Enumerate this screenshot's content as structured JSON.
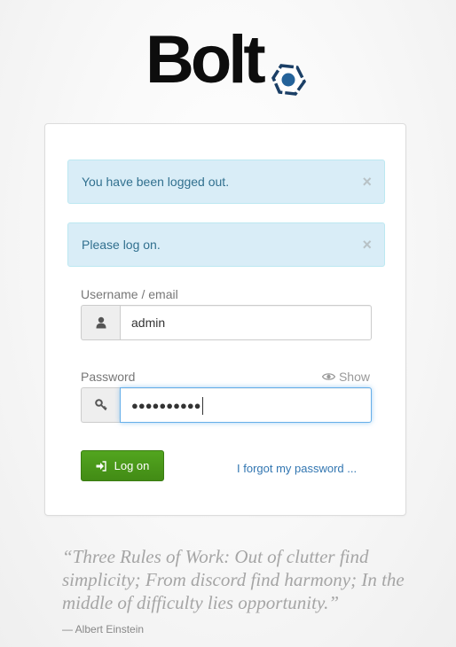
{
  "logo": {
    "text": "Bolt",
    "hex_color": "#1b3f66",
    "dot_color": "#25639a"
  },
  "alerts": [
    {
      "message": "You have been logged out.",
      "close": "×"
    },
    {
      "message": "Please log on.",
      "close": "×"
    }
  ],
  "form": {
    "username": {
      "label": "Username / email",
      "value": "admin",
      "icon": "user-icon"
    },
    "password": {
      "label": "Password",
      "value": "●●●●●●●●●●",
      "icon": "key-icon",
      "show_label": "Show"
    },
    "login_button": "Log on",
    "forgot_link": "I forgot my password ..."
  },
  "quote": {
    "text": "“Three Rules of Work: Out of clutter find simplicity; From discord find harmony; In the middle of difficulty lies opportunity.”",
    "author": "— Albert Einstein"
  },
  "colors": {
    "alert_bg": "#d9edf7",
    "alert_text": "#31708f",
    "button_green": "#4b9c1c",
    "link_blue": "#3276b1",
    "focus_blue": "#66afe9"
  }
}
